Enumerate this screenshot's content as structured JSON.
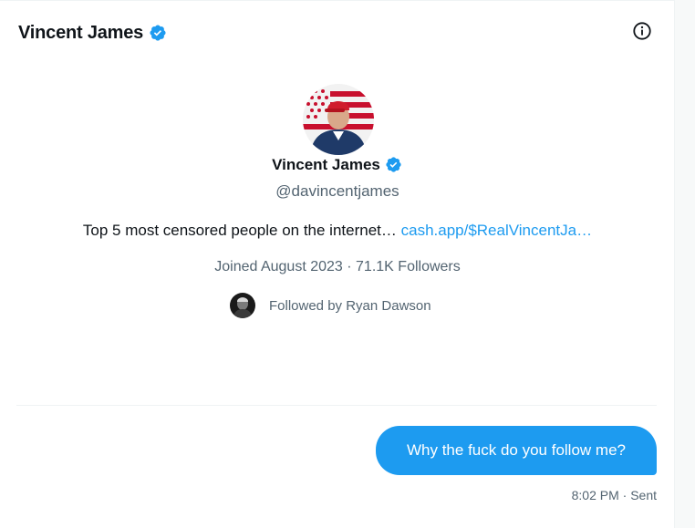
{
  "header": {
    "name": "Vincent James"
  },
  "profile": {
    "name": "Vincent James",
    "handle": "@davincentjames",
    "bio_text": "Top 5 most censored people on the internet… ",
    "bio_link": "cash.app/$RealVincentJa…",
    "joined": "Joined August 2023 · 71.1K Followers",
    "followed_by": "Followed by Ryan Dawson"
  },
  "message": {
    "text": "Why the fuck do you follow me?",
    "status": "8:02 PM · Sent"
  },
  "colors": {
    "accent": "#1d9bf0",
    "text": "#0f1419",
    "secondary": "#536471"
  },
  "icons": {
    "verified": "verified-badge-icon",
    "info": "info-icon"
  }
}
